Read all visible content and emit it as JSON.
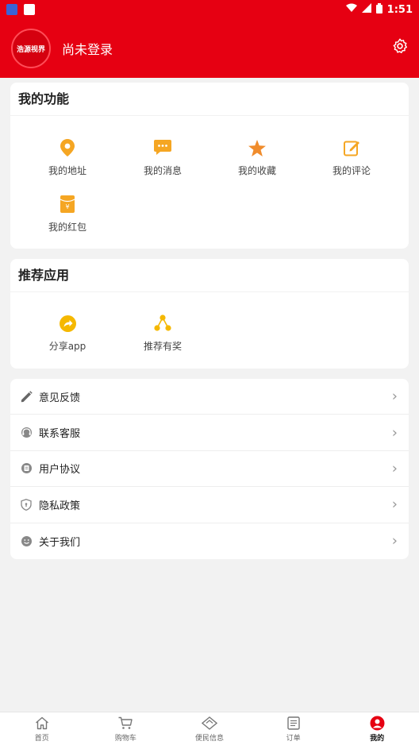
{
  "status": {
    "time": "1:51"
  },
  "header": {
    "avatar_text": "浩源视界",
    "login_text": "尚未登录"
  },
  "functions": {
    "title": "我的功能",
    "items": [
      {
        "label": "我的地址",
        "icon": "location-icon"
      },
      {
        "label": "我的消息",
        "icon": "message-icon"
      },
      {
        "label": "我的收藏",
        "icon": "star-icon"
      },
      {
        "label": "我的评论",
        "icon": "edit-icon"
      },
      {
        "label": "我的红包",
        "icon": "red-envelope-icon"
      }
    ]
  },
  "recommend": {
    "title": "推荐应用",
    "items": [
      {
        "label": "分享app",
        "icon": "share-icon"
      },
      {
        "label": "推荐有奖",
        "icon": "network-icon"
      }
    ]
  },
  "list": [
    {
      "label": "意见反馈",
      "icon": "pencil-icon"
    },
    {
      "label": "联系客服",
      "icon": "headset-icon"
    },
    {
      "label": "用户协议",
      "icon": "document-icon"
    },
    {
      "label": "隐私政策",
      "icon": "shield-icon"
    },
    {
      "label": "关于我们",
      "icon": "smile-icon"
    }
  ],
  "tabs": [
    {
      "label": "首页",
      "icon": "home-icon"
    },
    {
      "label": "购物车",
      "icon": "cart-icon"
    },
    {
      "label": "便民信息",
      "icon": "tag-icon"
    },
    {
      "label": "订单",
      "icon": "order-icon"
    },
    {
      "label": "我的",
      "icon": "profile-icon"
    }
  ],
  "colors": {
    "brand": "#e60012",
    "icon_orange": "#f5a623",
    "icon_deep": "#f08c2c"
  }
}
